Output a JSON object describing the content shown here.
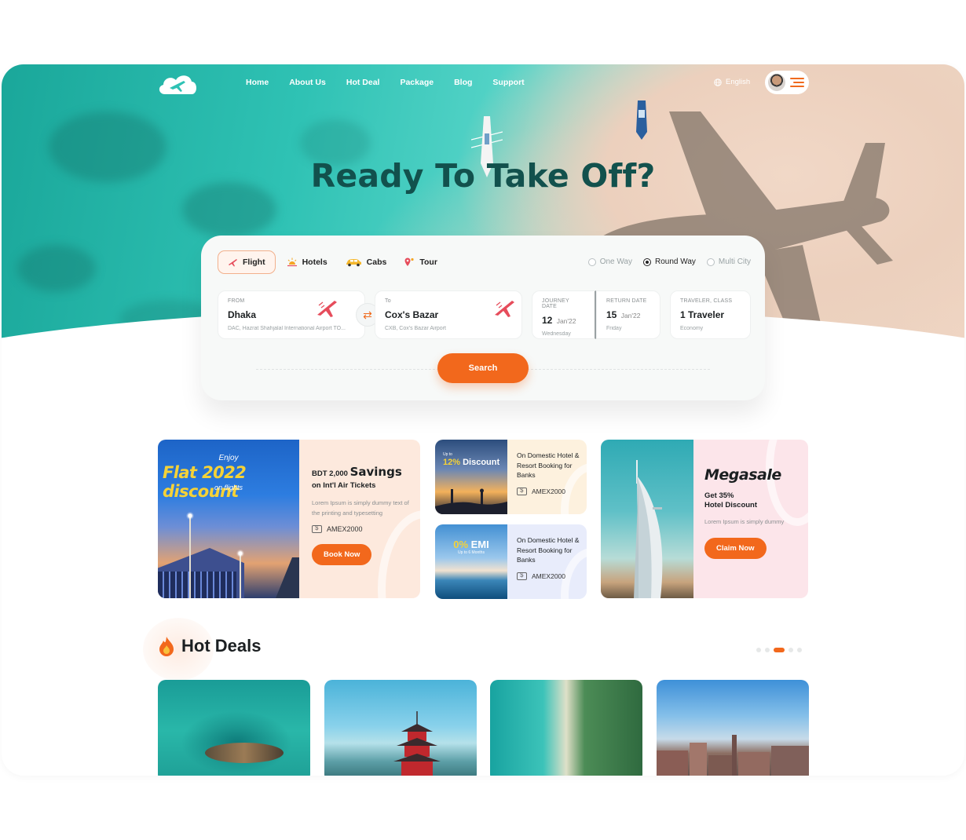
{
  "nav": {
    "links": [
      "Home",
      "About Us",
      "Hot Deal",
      "Package",
      "Blog",
      "Support"
    ],
    "language": "English"
  },
  "hero": {
    "title": "Ready To Take Off?"
  },
  "search": {
    "tabs": [
      "Flight",
      "Hotels",
      "Cabs",
      "Tour"
    ],
    "active_tab": "Flight",
    "trip_types": [
      "One Way",
      "Round Way",
      "Multi City"
    ],
    "selected_trip": "Round Way",
    "from": {
      "label": "FROM",
      "city": "Dhaka",
      "airport": "DAC, Hazrat Shahjalal International Airport TO..."
    },
    "to": {
      "label": "To",
      "city": "Cox's Bazar",
      "airport": "CXB, Cox's Bazar Airport"
    },
    "journey": {
      "label": "JOURNEY DATE",
      "day": "12",
      "month": "Jan'22",
      "weekday": "Wednesday"
    },
    "return": {
      "label": "RETURN DATE",
      "day": "15",
      "month": "Jan'22",
      "weekday": "Friday"
    },
    "traveler": {
      "label": "TRAVELER, CLASS",
      "value": "1 Traveler",
      "class": "Economy"
    },
    "button": "Search"
  },
  "promos": {
    "flight": {
      "img_enjoy": "Enjoy",
      "img_big": "Flat 2022 discount",
      "img_on": "on flights",
      "prefix": "BDT 2,000",
      "highlight": "Savings",
      "subtitle": "on Int'l Air Tickets",
      "desc": "Lorem Ipsum is simply dummy text of the printing and typesetting",
      "coupon": "AMEX2000",
      "button": "Book Now"
    },
    "hotel_discount": {
      "img_upto": "Up to",
      "img_pct": "12%",
      "img_word": "Discount",
      "title": "On Domestic Hotel & Resort Booking for Banks",
      "coupon": "AMEX2000"
    },
    "hotel_emi": {
      "img_pct": "0%",
      "img_word": "EMI",
      "img_sub": "Up to 6 Months",
      "title": "On Domestic Hotel & Resort Booking for Banks",
      "coupon": "AMEX2000"
    },
    "megasale": {
      "title": "Megasale",
      "subtitle_1": "Get 35%",
      "subtitle_2": "Hotel Discount",
      "desc": "Lorem Ipsum is simply dummy",
      "button": "Claim Now"
    }
  },
  "hot_deals": {
    "title": "Hot Deals",
    "dots": 5,
    "active_dot": 2
  },
  "colors": {
    "accent": "#f2681c",
    "hero_title": "#12514d",
    "teal": "#2fc2b4"
  }
}
